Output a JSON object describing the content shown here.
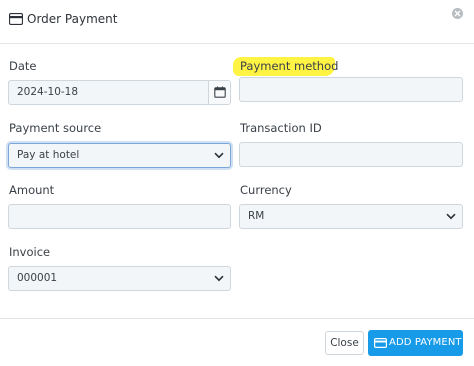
{
  "header": {
    "title": "Order Payment",
    "icon": "credit-card-icon",
    "close_icon": "close-icon"
  },
  "form": {
    "date": {
      "label": "Date",
      "value": "2024-10-18",
      "icon": "calendar-icon"
    },
    "payment_method": {
      "label": "Payment method",
      "value": ""
    },
    "payment_source": {
      "label": "Payment source",
      "value": "Pay at hotel"
    },
    "transaction_id": {
      "label": "Transaction ID",
      "value": ""
    },
    "amount": {
      "label": "Amount",
      "value": ""
    },
    "currency": {
      "label": "Currency",
      "value": "RM"
    },
    "invoice": {
      "label": "Invoice",
      "value": "000001"
    }
  },
  "footer": {
    "close_label": "Close",
    "add_label": "ADD PAYMENT",
    "add_icon": "credit-card-icon"
  },
  "colors": {
    "primary": "#179ae8",
    "highlight": "#fff23a",
    "focus_border": "#7aa6d8"
  }
}
